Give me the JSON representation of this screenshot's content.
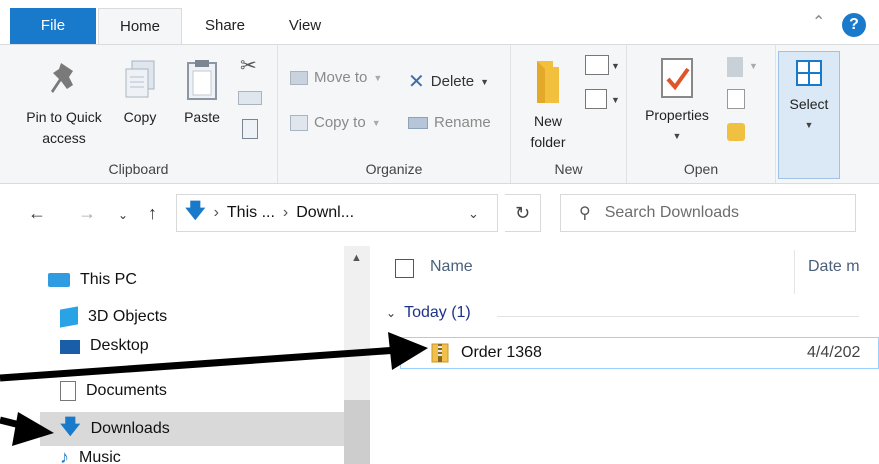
{
  "tabs": {
    "file": "File",
    "home": "Home",
    "share": "Share",
    "view": "View"
  },
  "help": "?",
  "ribbon": {
    "clipboard": {
      "label": "Clipboard",
      "pin_line1": "Pin to Quick",
      "pin_line2": "access",
      "copy": "Copy",
      "paste": "Paste"
    },
    "organize": {
      "label": "Organize",
      "move_to": "Move to",
      "copy_to": "Copy to",
      "delete": "Delete",
      "rename": "Rename"
    },
    "new": {
      "label": "New",
      "new_folder_line1": "New",
      "new_folder_line2": "folder"
    },
    "open": {
      "label": "Open",
      "properties": "Properties"
    },
    "select": {
      "select": "Select"
    }
  },
  "address": {
    "seg1": "This ...",
    "seg2": "Downl...",
    "search_placeholder": "Search Downloads"
  },
  "nav_pane": {
    "items": [
      {
        "label": "This PC",
        "icon": "computer-icon"
      },
      {
        "label": "3D Objects",
        "icon": "cube-icon"
      },
      {
        "label": "Desktop",
        "icon": "desktop-icon"
      },
      {
        "label": "Documents",
        "icon": "document-icon"
      },
      {
        "label": "Downloads",
        "icon": "download-arrow-icon"
      },
      {
        "label": "Music",
        "icon": "music-note-icon"
      }
    ]
  },
  "content": {
    "columns": {
      "name": "Name",
      "date": "Date m"
    },
    "group_label": "Today (1)",
    "files": [
      {
        "name": "Order 1368",
        "date": "4/4/202",
        "icon": "zip-folder-icon"
      }
    ]
  },
  "colors": {
    "accent": "#1979ca",
    "selection_border": "#99d1ff",
    "group_header": "#1e3287"
  }
}
